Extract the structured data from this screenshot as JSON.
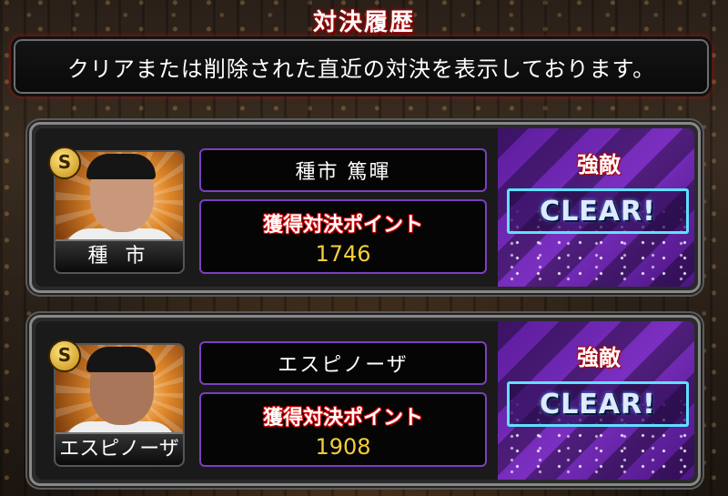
{
  "header": {
    "title": "対決履歴",
    "notice": "クリアまたは削除された直近の対決を表示しております。"
  },
  "colors": {
    "panel_border": "#888888",
    "box_border": "#7a40c0",
    "points_value": "#f3cf3a",
    "clear_border": "#5fe0ff",
    "result_bg": "#7b2fc0"
  },
  "battles": [
    {
      "badge": "S",
      "card_name": "種 市",
      "player_name": "種市 篤暉",
      "points_label": "獲得対決ポイント",
      "points": "1746",
      "difficulty": "強敵",
      "result": "CLEAR!",
      "avatar_icon": "player-portrait-icon"
    },
    {
      "badge": "S",
      "card_name": "エスピノーザ",
      "player_name": "エスピノーザ",
      "points_label": "獲得対決ポイント",
      "points": "1908",
      "difficulty": "強敵",
      "result": "CLEAR!",
      "avatar_icon": "player-portrait-icon"
    }
  ]
}
